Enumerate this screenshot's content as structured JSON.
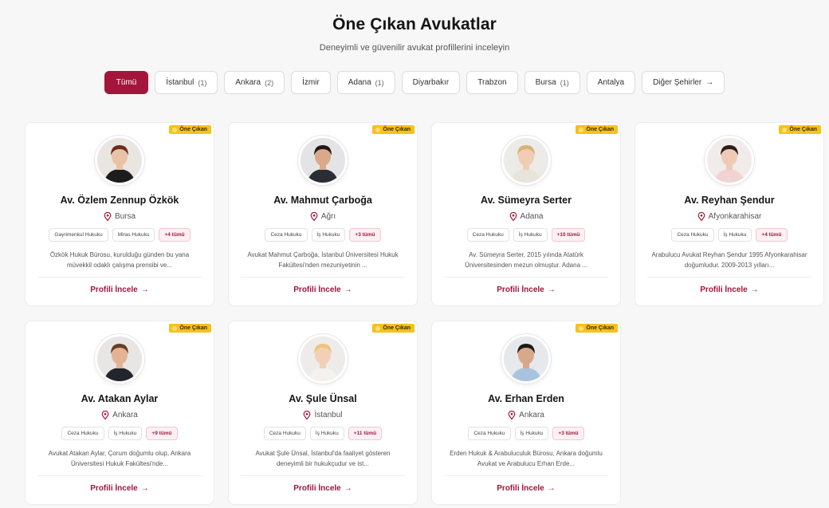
{
  "header": {
    "title": "Öne Çıkan Avukatlar",
    "subtitle": "Deneyimli ve güvenilir avukat profillerini inceleyin"
  },
  "filters": [
    {
      "label": "Tümü",
      "count": "",
      "active": true
    },
    {
      "label": "İstanbul",
      "count": "(1)"
    },
    {
      "label": "Ankara",
      "count": "(2)"
    },
    {
      "label": "İzmir",
      "count": ""
    },
    {
      "label": "Adana",
      "count": "(1)"
    },
    {
      "label": "Diyarbakır",
      "count": ""
    },
    {
      "label": "Trabzon",
      "count": ""
    },
    {
      "label": "Bursa",
      "count": "(1)"
    },
    {
      "label": "Antalya",
      "count": ""
    },
    {
      "label": "Diğer Şehirler",
      "count": "",
      "arrow": "→"
    }
  ],
  "badge_label": "Öne Çıkan",
  "link_label": "Profili İncele",
  "link_arrow": "→",
  "colors": {
    "accent": "#a3153a",
    "badge": "#f6c21b"
  },
  "lawyers": [
    {
      "name": "Av. Özlem Zennup Özkök",
      "city": "Bursa",
      "tags": [
        "Gayrimenkul Hukuku",
        "Miras Hukuku",
        "+4 tümü"
      ],
      "desc": "Özkök Hukuk Bürosu, kurulduğu günden bu yana müvekkil odaklı çalışma prensibi ve...",
      "avatar": {
        "skin": "#e9c3a6",
        "hair": "#6b2d1c",
        "cloth": "#1d1d1d",
        "bg": "#e9e6e2"
      }
    },
    {
      "name": "Av. Mahmut Çarboğa",
      "city": "Ağrı",
      "tags": [
        "Ceza Hukuku",
        "İş Hukuku",
        "+3 tümü"
      ],
      "desc": "Avukat Mahmut Çarboğa, İstanbul Üniversitesi Hukuk Fakültesi'nden mezuniyetinin ...",
      "avatar": {
        "skin": "#d9a98a",
        "hair": "#1e1a18",
        "cloth": "#2a2d33",
        "bg": "#e4e4e6"
      }
    },
    {
      "name": "Av. Sümeyra Serter",
      "city": "Adana",
      "tags": [
        "Ceza Hukuku",
        "İş Hukuku",
        "+10 tümü"
      ],
      "desc": "Av. Sümeyra Serter, 2015 yılında Atatürk Üniversitesinden mezun olmuştur. Adana ...",
      "avatar": {
        "skin": "#f0cdb4",
        "hair": "#d8b277",
        "cloth": "#e8e4dc",
        "bg": "#ecebe7"
      }
    },
    {
      "name": "Av. Reyhan Şendur",
      "city": "Afyonkarahisar",
      "tags": [
        "Ceza Hukuku",
        "İş Hukuku",
        "+4 tümü"
      ],
      "desc": "Arabulucu Avukat Reyhan Şendur 1995 Afyonkarahisar doğumludur. 2009-2013 yılları...",
      "avatar": {
        "skin": "#efcbb6",
        "hair": "#2b1d18",
        "cloth": "#f2d3d4",
        "bg": "#f1ecea"
      }
    },
    {
      "name": "Av. Atakan Aylar",
      "city": "Ankara",
      "tags": [
        "Ceza Hukuku",
        "İş Hukuku",
        "+9 tümü"
      ],
      "desc": "Avukat Atakan Aylar, Çorum doğumlu olup, Ankara Üniversitesi Hukuk Fakültesi'nde...",
      "avatar": {
        "skin": "#e2b394",
        "hair": "#6a3f25",
        "cloth": "#22252b",
        "bg": "#e7e6e4"
      }
    },
    {
      "name": "Av. Şule Ünsal",
      "city": "İstanbul",
      "tags": [
        "Ceza Hukuku",
        "İş Hukuku",
        "+11 tümü"
      ],
      "desc": "Avukat Şule Ünsal, İstanbul'da faaliyet gösteren deneyimli bir hukukçudur ve ist...",
      "avatar": {
        "skin": "#f2d0b8",
        "hair": "#e9c67a",
        "cloth": "#f4f1ee",
        "bg": "#eeeceb"
      }
    },
    {
      "name": "Av. Erhan Erden",
      "city": "Ankara",
      "tags": [
        "Ceza Hukuku",
        "İş Hukuku",
        "+3 tümü"
      ],
      "desc": "Erden Hukuk & Arabuluculuk Bürosu, Ankara doğumlu Avukat ve Arabulucu Erhan Erde...",
      "avatar": {
        "skin": "#d8a88a",
        "hair": "#1c1a19",
        "cloth": "#a9c3df",
        "bg": "#e6e8eb"
      }
    }
  ]
}
